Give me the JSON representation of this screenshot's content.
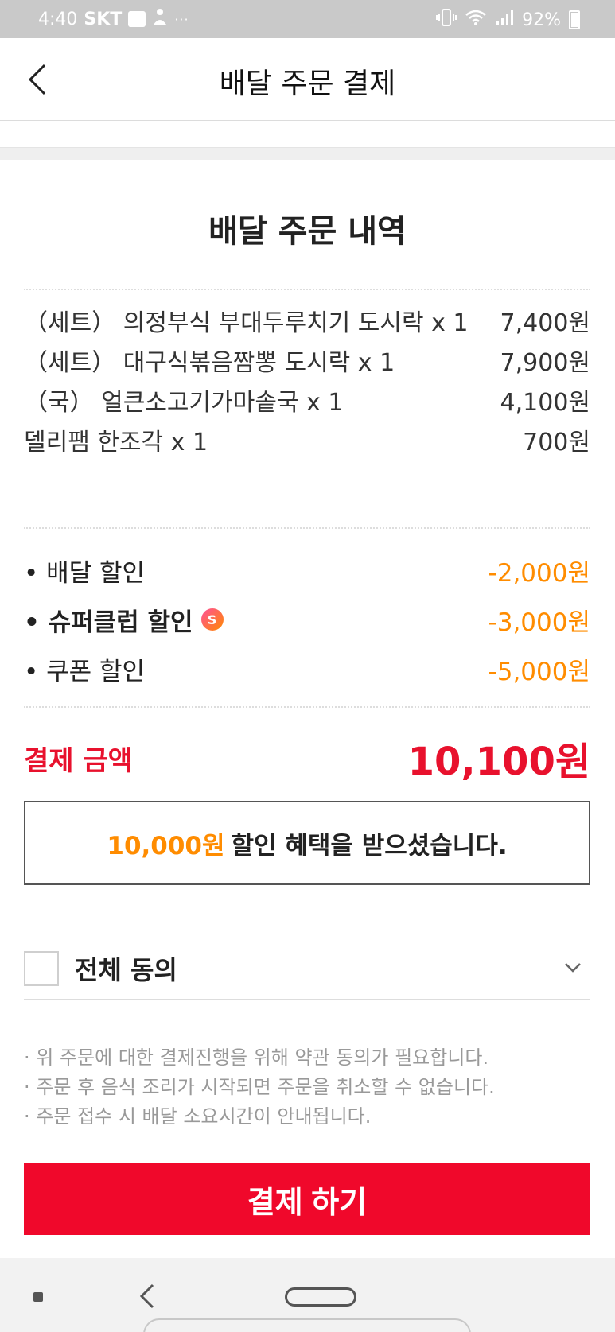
{
  "status_bar": {
    "time": "4:40",
    "carrier": "SKT",
    "dots": "···",
    "battery": "92%"
  },
  "header": {
    "title": "배달 주문 결제"
  },
  "order": {
    "title": "배달 주문 내역",
    "items": [
      {
        "name": "（세트） 의정부식 부대두루치기 도시락 x 1",
        "price": "7,400원"
      },
      {
        "name": "（세트） 대구식볶음짬뽕 도시락 x 1",
        "price": "7,900원"
      },
      {
        "name": "（국） 얼큰소고기가마솥국 x 1",
        "price": "4,100원"
      },
      {
        "name": "델리팸 한조각 x 1",
        "price": "700원"
      }
    ]
  },
  "discounts": [
    {
      "name": "• 배달 할인",
      "value": "-2,000원"
    },
    {
      "name": "• 슈퍼클럽 할인",
      "value": "-3,000원"
    },
    {
      "name": "• 쿠폰 할인",
      "value": "-5,000원"
    }
  ],
  "total": {
    "label": "결제 금액",
    "amount": "10,100원"
  },
  "benefit": {
    "amount": "10,000원",
    "text": "할인 혜택을 받으셨습니다."
  },
  "agree": {
    "label": "전체 동의",
    "checked": false
  },
  "notices": [
    "· 위 주문에 대한 결제진행을 위해 약관 동의가 필요합니다.",
    "· 주문 후 음식 조리가 시작되면 주문을 취소할 수 없습니다.",
    "· 주문 접수 시 배달 소요시간이 안내됩니다."
  ],
  "pay_button": {
    "label": "결제 하기"
  },
  "colors": {
    "accent_red": "#f0082b",
    "discount_orange": "#ff8c00"
  }
}
